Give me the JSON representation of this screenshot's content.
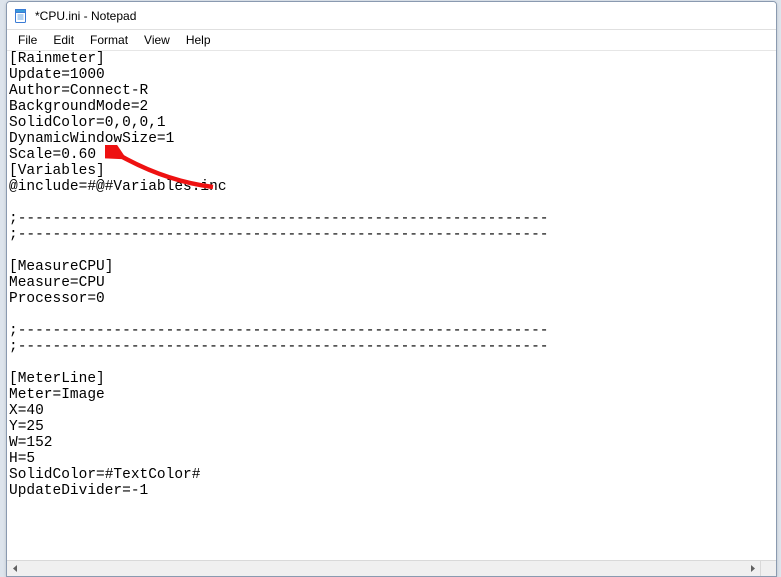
{
  "window": {
    "title": "*CPU.ini - Notepad"
  },
  "menu": {
    "file": "File",
    "edit": "Edit",
    "format": "Format",
    "view": "View",
    "help": "Help"
  },
  "editor": {
    "content": "[Rainmeter]\nUpdate=1000\nAuthor=Connect-R\nBackgroundMode=2\nSolidColor=0,0,0,1\nDynamicWindowSize=1\nScale=0.60\n[Variables]\n@include=#@#Variables.inc\n\n;-------------------------------------------------------------\n;-------------------------------------------------------------\n\n[MeasureCPU]\nMeasure=CPU\nProcessor=0\n\n;-------------------------------------------------------------\n;-------------------------------------------------------------\n\n[MeterLine]\nMeter=Image\nX=40\nY=25\nW=152\nH=5\nSolidColor=#TextColor#\nUpdateDivider=-1"
  },
  "annotation": {
    "arrow_target": "Scale=0.60"
  }
}
